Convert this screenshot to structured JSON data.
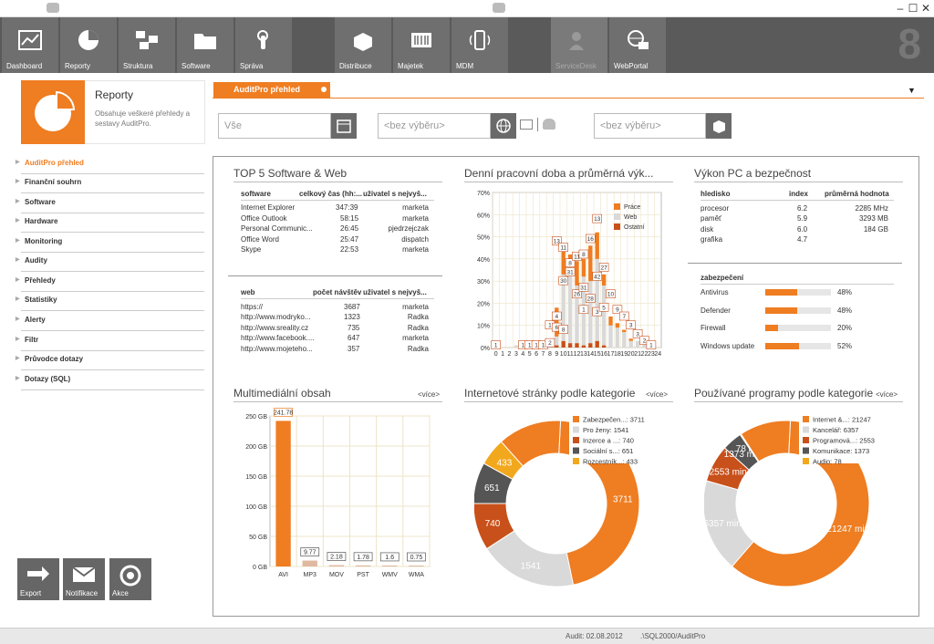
{
  "toolbar": {
    "items": [
      {
        "label": "Dashboard",
        "icon": "chart-icon"
      },
      {
        "label": "Reporty",
        "icon": "pie-icon"
      },
      {
        "label": "Struktura",
        "icon": "structure-icon"
      },
      {
        "label": "Software",
        "icon": "folder-icon"
      },
      {
        "label": "Správa",
        "icon": "touch-icon"
      },
      {
        "label": "Distribuce",
        "icon": "box-icon"
      },
      {
        "label": "Majetek",
        "icon": "barcode-icon"
      },
      {
        "label": "MDM",
        "icon": "mobile-icon"
      },
      {
        "label": "ServiceDesk",
        "icon": "servicedesk-icon"
      },
      {
        "label": "WebPortal",
        "icon": "globe-icon"
      }
    ],
    "logo": "8"
  },
  "reports_card": {
    "title": "Reporty",
    "desc": "Obsahuje veškeré přehledy a sestavy AuditPro."
  },
  "nav": [
    "AuditPro přehled",
    "Finanční souhrn",
    "Software",
    "Hardware",
    "Monitoring",
    "Audity",
    "Přehledy",
    "Statistiky",
    "Alerty",
    "Filtr",
    "Průvodce dotazy",
    "Dotazy (SQL)"
  ],
  "bottom_buttons": [
    "Export",
    "Notifikace",
    "Akce"
  ],
  "tab": "AuditPro přehled",
  "filters": {
    "f1": "Vše",
    "f2": "<bez výběru>",
    "f3": "<bez výběru>"
  },
  "panels": {
    "top5": {
      "title": "TOP 5 Software & Web",
      "sw_headers": [
        "software",
        "celkový čas (hh:...",
        "uživatel s nejvyš..."
      ],
      "sw_rows": [
        [
          "Internet Explorer",
          "347:39",
          "marketa"
        ],
        [
          "Office Outlook",
          "58:15",
          "marketa"
        ],
        [
          "Personal Communic...",
          "26:45",
          "pjedrzejczak"
        ],
        [
          "Office Word",
          "25:47",
          "dispatch"
        ],
        [
          "Skype",
          "22:53",
          "marketa"
        ]
      ],
      "web_headers": [
        "web",
        "počet návštěv",
        "uživatel s nejvyš..."
      ],
      "web_rows": [
        [
          "https://",
          "3687",
          "marketa"
        ],
        [
          "http://www.modryko...",
          "1323",
          "Radka"
        ],
        [
          "http://www.sreality.cz",
          "735",
          "Radka"
        ],
        [
          "http://www.facebook....",
          "647",
          "marketa"
        ],
        [
          "http://www.mojeteho...",
          "357",
          "Radka"
        ]
      ]
    },
    "daily": {
      "title": "Denní pracovní doba a průměrná výk..."
    },
    "perf": {
      "title": "Výkon PC a bezpečnost",
      "headers": [
        "hledisko",
        "index",
        "průměrná hodnota"
      ],
      "rows": [
        [
          "procesor",
          "6.2",
          "2285 MHz"
        ],
        [
          "paměť",
          "5.9",
          "3293 MB"
        ],
        [
          "disk",
          "6.0",
          "184 GB"
        ],
        [
          "grafika",
          "4.7",
          ""
        ]
      ],
      "sec_header": "zabezpečení",
      "sec_rows": [
        {
          "label": "Antivirus",
          "pct": "48%",
          "value": 48
        },
        {
          "label": "Defender",
          "pct": "48%",
          "value": 48
        },
        {
          "label": "Firewall",
          "pct": "20%",
          "value": 20
        },
        {
          "label": "Windows update",
          "pct": "52%",
          "value": 52
        }
      ]
    },
    "media": {
      "title": "Multimediální obsah",
      "more": "<více>"
    },
    "web_cat": {
      "title": "Internetové stránky podle kategorie",
      "more": "<více>"
    },
    "prog_cat": {
      "title": "Používané programy podle kategorie",
      "more": "<více>"
    }
  },
  "chart_data": [
    {
      "type": "bar",
      "title": "Denní pracovní doba a průměrná výk...",
      "categories": [
        "0",
        "1",
        "2",
        "3",
        "4",
        "5",
        "6",
        "7",
        "8",
        "9",
        "10",
        "11",
        "12",
        "13",
        "14",
        "15",
        "16",
        "17",
        "18",
        "19",
        "20",
        "21",
        "22",
        "23",
        "24"
      ],
      "ylim": [
        0,
        70
      ],
      "yticks": [
        "0%",
        "10%",
        "20%",
        "30%",
        "40%",
        "50%",
        "60%",
        "70%"
      ],
      "series": [
        {
          "name": "Práce",
          "color": "#ef7d21",
          "values": [
            1,
            0,
            0,
            0,
            0,
            0,
            0,
            0,
            2,
            13,
            11,
            9,
            11,
            8,
            16,
            12,
            5,
            4,
            2,
            1,
            1,
            0,
            0,
            0,
            0
          ]
        },
        {
          "name": "Web",
          "color": "#d9d9d9",
          "values": [
            0,
            0,
            0,
            1,
            1,
            1,
            1,
            1,
            2,
            4,
            30,
            31,
            26,
            31,
            28,
            37,
            27,
            10,
            9,
            7,
            3,
            3,
            2,
            1,
            0
          ]
        },
        {
          "name": "Ostatní",
          "color": "#c8501a",
          "values": [
            0,
            0,
            0,
            0,
            0,
            0,
            0,
            0,
            0,
            1,
            3,
            2,
            2,
            1,
            2,
            3,
            1,
            0,
            0,
            0,
            0,
            0,
            0,
            0,
            0
          ]
        }
      ],
      "labels": [
        {
          "x": 0,
          "y": 1,
          "t": "1"
        },
        {
          "x": 4,
          "y": 1,
          "t": "1"
        },
        {
          "x": 5,
          "y": 1,
          "t": "1"
        },
        {
          "x": 6,
          "y": 1,
          "t": "1"
        },
        {
          "x": 7,
          "y": 1,
          "t": "1"
        },
        {
          "x": 8,
          "y": 2,
          "t": "2"
        },
        {
          "x": 8,
          "y": 10,
          "t": "1"
        },
        {
          "x": 9,
          "y": 48,
          "t": "13"
        },
        {
          "x": 9,
          "y": 14,
          "t": "4"
        },
        {
          "x": 9,
          "y": 9,
          "t": "6"
        },
        {
          "x": 10,
          "y": 45,
          "t": "11"
        },
        {
          "x": 10,
          "y": 30,
          "t": "30"
        },
        {
          "x": 10,
          "y": 8,
          "t": "8"
        },
        {
          "x": 11,
          "y": 38,
          "t": "8"
        },
        {
          "x": 11,
          "y": 34,
          "t": "31"
        },
        {
          "x": 12,
          "y": 41,
          "t": "11"
        },
        {
          "x": 12,
          "y": 24,
          "t": "26"
        },
        {
          "x": 13,
          "y": 27,
          "t": "31"
        },
        {
          "x": 13,
          "y": 42,
          "t": "8"
        },
        {
          "x": 13,
          "y": 17,
          "t": "1"
        },
        {
          "x": 14,
          "y": 49,
          "t": "16"
        },
        {
          "x": 14,
          "y": 22,
          "t": "28"
        },
        {
          "x": 15,
          "y": 58,
          "t": "13"
        },
        {
          "x": 15,
          "y": 32,
          "t": "42"
        },
        {
          "x": 15,
          "y": 16,
          "t": "3"
        },
        {
          "x": 16,
          "y": 36,
          "t": "27"
        },
        {
          "x": 16,
          "y": 18,
          "t": "5"
        },
        {
          "x": 17,
          "y": 24,
          "t": "10"
        },
        {
          "x": 18,
          "y": 17,
          "t": "9"
        },
        {
          "x": 19,
          "y": 14,
          "t": "7"
        },
        {
          "x": 20,
          "y": 10,
          "t": "3"
        },
        {
          "x": 21,
          "y": 6,
          "t": "3"
        },
        {
          "x": 22,
          "y": 3,
          "t": "2"
        },
        {
          "x": 23,
          "y": 1,
          "t": "1"
        }
      ]
    },
    {
      "type": "bar",
      "title": "Multimediální obsah",
      "categories": [
        "AVI",
        "MP3",
        "MOV",
        "PST",
        "WMV",
        "WMA"
      ],
      "values": [
        241.78,
        9.77,
        2.18,
        1.78,
        1.6,
        0.75
      ],
      "labels": [
        "241.78",
        "9.77",
        "2.18",
        "1.78",
        "1.6",
        "0.75"
      ],
      "ylim": [
        0,
        250
      ],
      "yticks": [
        "0 GB",
        "50 GB",
        "100 GB",
        "150 GB",
        "200 GB",
        "250 GB"
      ]
    },
    {
      "type": "pie",
      "title": "Internetové stránky podle kategorie",
      "legend": [
        "Zabezpečen...: 3711",
        "Pro ženy: 1541",
        "Inzerce a ...: 740",
        "Sociální s...: 651",
        "Rozcestník...: 433"
      ],
      "values": [
        3711,
        1541,
        740,
        651,
        433,
        1000
      ],
      "labels": [
        "3711",
        "1541",
        "740",
        "651",
        "433",
        ""
      ],
      "colors": [
        "#ef7d21",
        "#d9d9d9",
        "#c8501a",
        "#555555",
        "#f2a81d",
        "#ef7d21"
      ]
    },
    {
      "type": "pie",
      "title": "Používané programy podle kategorie",
      "legend": [
        "Internet &...: 21247",
        "Kancelář: 6357",
        "Programová...: 2553",
        "Komunikace: 1373",
        "Audio: 78"
      ],
      "values": [
        21247,
        6357,
        2553,
        1373,
        78,
        3500
      ],
      "labels": [
        "21247 min",
        "6357 min",
        "2553 min",
        "1373 min",
        "78 min",
        ""
      ],
      "colors": [
        "#ef7d21",
        "#d9d9d9",
        "#c8501a",
        "#555555",
        "#f2a81d",
        "#ef7d21"
      ]
    }
  ],
  "status": {
    "audit": "Audit: 02.08.2012",
    "server": ".\\SQL2000/AuditPro"
  }
}
